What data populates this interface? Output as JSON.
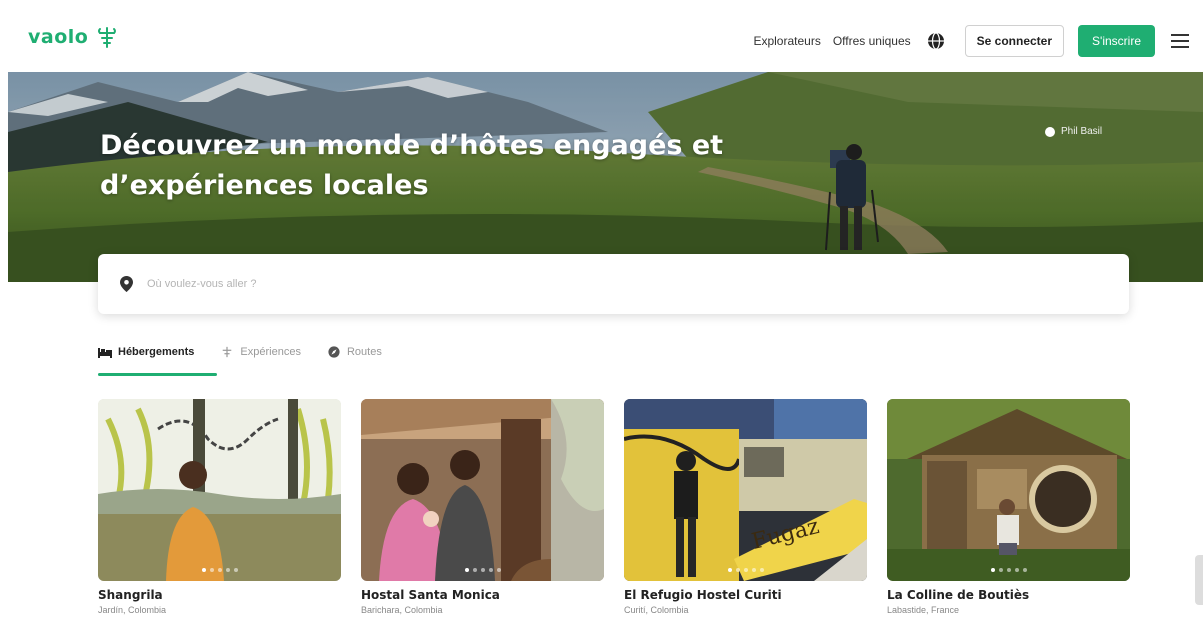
{
  "header": {
    "logo_text": "vaolo",
    "logo_icon": "seedling-icon",
    "nav_links": [
      "Explorateurs",
      "Offres uniques"
    ],
    "globe_icon": "globe-icon",
    "login_label": "Se connecter",
    "signup_label": "S'inscrire",
    "menu_icon": "hamburger-icon"
  },
  "hero": {
    "title": "Découvrez un monde d’hôtes engagés et d’expériences locales",
    "photo_credit": "Phil Basil"
  },
  "search": {
    "placeholder": "Où voulez-vous aller ?",
    "icon": "map-pin-icon"
  },
  "tabs": [
    {
      "label": "Hébergements",
      "icon": "bed-icon",
      "active": true
    },
    {
      "label": "Expériences",
      "icon": "seedling-icon",
      "active": false
    },
    {
      "label": "Routes",
      "icon": "compass-icon",
      "active": false
    }
  ],
  "cards": [
    {
      "title": "Shangrila",
      "subtitle": "Jardín, Colombia"
    },
    {
      "title": "Hostal Santa Monica",
      "subtitle": "Barichara, Colombia"
    },
    {
      "title": "El Refugio Hostel Curiti",
      "subtitle": "Curití, Colombia"
    },
    {
      "title": "La Colline de Boutiès",
      "subtitle": "Labastide, France"
    }
  ],
  "colors": {
    "brand": "#1fae72",
    "text": "#222222",
    "muted": "#999999"
  }
}
